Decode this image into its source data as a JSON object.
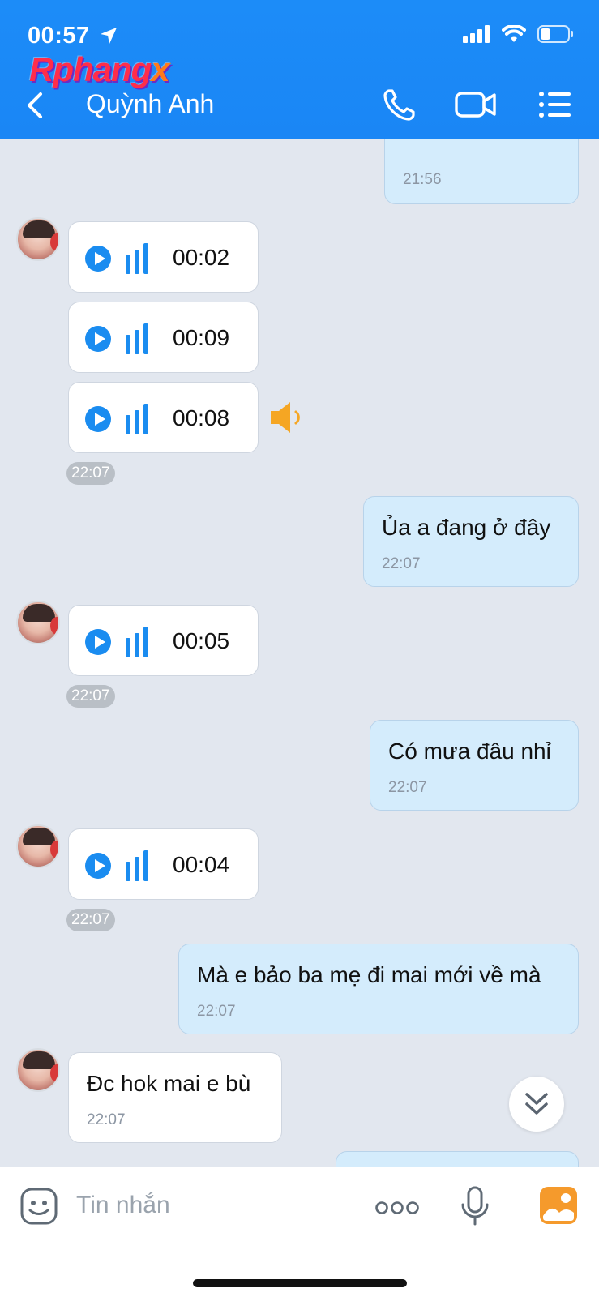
{
  "status": {
    "time": "00:57"
  },
  "watermark": {
    "main": "Rphang",
    "accent": "x"
  },
  "header": {
    "contact_name": "Quỳnh Anh"
  },
  "messages": {
    "top_partial_time": "21:56",
    "voice1": "00:02",
    "voice2": "00:09",
    "voice3": "00:08",
    "group1_time": "22:07",
    "me1_text": "Ủa a đang ở đây",
    "me1_time": "22:07",
    "voice4": "00:05",
    "group2_time": "22:07",
    "me2_text": "Có mưa đâu nhỉ",
    "me2_time": "22:07",
    "voice5": "00:04",
    "group3_time": "22:07",
    "me3_text": "Mà e bảo ba mẹ đi mai mới về mà",
    "me3_time": "22:07",
    "them1_text": "Đc hok mai e bù",
    "them1_time": "22:07"
  },
  "input": {
    "placeholder": "Tin nhắn"
  },
  "colors": {
    "header": "#1c8cf8",
    "accent": "#1a8cf0",
    "my_bubble": "#d4ecfc",
    "speaker": "#f5a623",
    "gallery": "#f59a2c"
  }
}
